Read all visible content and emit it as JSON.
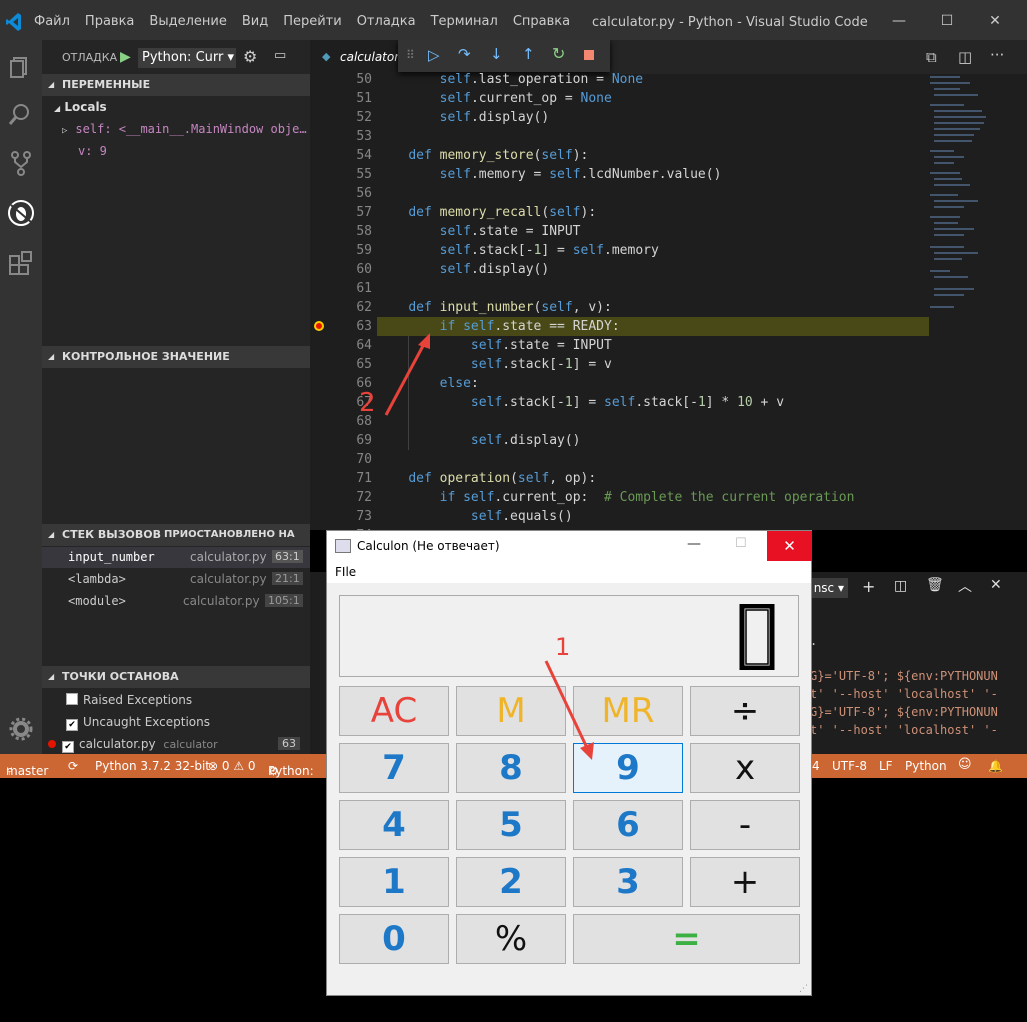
{
  "titlebar": {
    "menu": [
      "Файл",
      "Правка",
      "Выделение",
      "Вид",
      "Перейти",
      "Отладка",
      "Терминал",
      "Справка"
    ],
    "title": "calculator.py - Python - Visual Studio Code"
  },
  "debug": {
    "label": "ОТЛАДКА",
    "config": "Python: Curr"
  },
  "tab": {
    "filename": "calculator."
  },
  "sidebar": {
    "variables_header": "ПЕРЕМЕННЫЕ",
    "locals_label": "Locals",
    "var_self": "self: <__main__.MainWindow obje…",
    "var_v": "v: 9",
    "watch_header": "КОНТРОЛЬНОЕ ЗНАЧЕНИЕ",
    "callstack_header": "СТЕК ВЫЗОВОВ",
    "callstack_status": "ПРИОСТАНОВЛЕНО НА BREA…",
    "callstack": [
      {
        "name": "input_number",
        "file": "calculator.py",
        "pos": "63:1"
      },
      {
        "name": "<lambda>",
        "file": "calculator.py",
        "pos": "21:1"
      },
      {
        "name": "<module>",
        "file": "calculator.py",
        "pos": "105:1"
      }
    ],
    "breakpoints_header": "ТОЧКИ ОСТАНОВА",
    "bp_raised": "Raised Exceptions",
    "bp_uncaught": "Uncaught Exceptions",
    "bp_file": "calculator.py",
    "bp_file_dir": "calculator",
    "bp_file_line": "63"
  },
  "code": [
    {
      "n": "50",
      "t": "        self.last_operation = None"
    },
    {
      "n": "51",
      "t": "        self.current_op = None"
    },
    {
      "n": "52",
      "t": "        self.display()"
    },
    {
      "n": "53",
      "t": ""
    },
    {
      "n": "54",
      "t": "    def memory_store(self):"
    },
    {
      "n": "55",
      "t": "        self.memory = self.lcdNumber.value()"
    },
    {
      "n": "56",
      "t": ""
    },
    {
      "n": "57",
      "t": "    def memory_recall(self):"
    },
    {
      "n": "58",
      "t": "        self.state = INPUT"
    },
    {
      "n": "59",
      "t": "        self.stack[-1] = self.memory"
    },
    {
      "n": "60",
      "t": "        self.display()"
    },
    {
      "n": "61",
      "t": ""
    },
    {
      "n": "62",
      "t": "    def input_number(self, v):"
    },
    {
      "n": "63",
      "t": "        if self.state == READY:"
    },
    {
      "n": "64",
      "t": "            self.state = INPUT"
    },
    {
      "n": "65",
      "t": "            self.stack[-1] = v"
    },
    {
      "n": "66",
      "t": "        else:"
    },
    {
      "n": "67",
      "t": "            self.stack[-1] = self.stack[-1] * 10 + v"
    },
    {
      "n": "68",
      "t": ""
    },
    {
      "n": "69",
      "t": "            self.display()"
    },
    {
      "n": "70",
      "t": ""
    },
    {
      "n": "71",
      "t": "    def operation(self, op):"
    },
    {
      "n": "72",
      "t": "        if self.current_op:  # Complete the current operation"
    },
    {
      "n": "73",
      "t": "            self.equals()"
    },
    {
      "n": "74",
      "t": ""
    }
  ],
  "panel": {
    "dropdown": "nsc",
    "lines": [
      ".",
      "G}='UTF-8'; ${env:PYTHONUN",
      "t' '--host' 'localhost' '-",
      "G}='UTF-8'; ${env:PYTHONUN",
      "t' '--host' 'localhost' '-"
    ]
  },
  "status": {
    "branch": "master",
    "python": "Python 3.7.2 32-bit",
    "problems": "⊗ 0 ⚠ 0",
    "debug": "Python:",
    "col": "4",
    "encoding": "UTF-8",
    "eol": "LF",
    "lang": "Python"
  },
  "calc": {
    "title": "Calculon (Не отвечает)",
    "menu_file": "FIle",
    "display": "0",
    "buttons": [
      "AC",
      "M",
      "MR",
      "÷",
      "7",
      "8",
      "9",
      "x",
      "4",
      "5",
      "6",
      "-",
      "1",
      "2",
      "3",
      "+",
      "0",
      "%",
      "="
    ]
  },
  "annotations": {
    "one": "1",
    "two": "2"
  },
  "colors": {
    "statusbar": "#cc6633",
    "accent": "#e8433a",
    "digits": "#1e78c8"
  }
}
